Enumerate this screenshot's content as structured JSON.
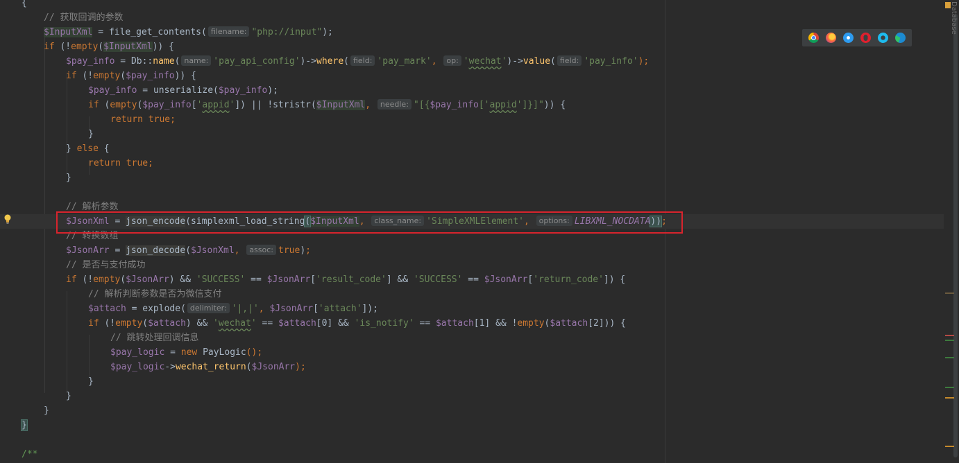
{
  "editor": {
    "side_panel_label": "Database",
    "browser_icons": [
      "chrome-icon",
      "firefox-icon",
      "safari-icon",
      "opera-icon",
      "ie-icon",
      "edge-icon"
    ],
    "lines": {
      "l0": "{",
      "l1_comment": "// 获取回调的参数",
      "l2": {
        "var": "$InputXml",
        "eq": " = ",
        "fn": "file_get_contents(",
        "hint": "filename:",
        "str": "\"php://input\"",
        "end": ");"
      },
      "l3": {
        "kw": "if",
        "open": " (!",
        "fn": "empty",
        "p1": "(",
        "var": "$InputXml",
        "end": ")) {"
      },
      "l4": {
        "var": "$pay_info",
        "eq": " = ",
        "cls": "Db::",
        "fn1": "name",
        "p1": "(",
        "hint1": "name:",
        "str1": "'pay_api_config'",
        "arrow1": ")->",
        "fn2": "where",
        "p2": "(",
        "hint2": "field:",
        "str2": "'pay_mark'",
        "comma": ", ",
        "hint3": "op:",
        "str3a": "'",
        "str3b": "wechat",
        "str3c": "'",
        "arrow2": ")->",
        "fn3": "value",
        "p3": "(",
        "hint4": "field:",
        "str4": "'pay_info'",
        "end": ");"
      },
      "l5": {
        "kw": "if",
        "open": " (!",
        "fn": "empty",
        "p1": "(",
        "var": "$pay_info",
        "end": ")) {"
      },
      "l6": {
        "var1": "$pay_info",
        "eq": " = ",
        "fn": "unserialize",
        "p1": "(",
        "var2": "$pay_info",
        "end": ");"
      },
      "l7": {
        "kw": "if",
        "open": " (",
        "fn1": "empty",
        "p1": "(",
        "var1": "$pay_info",
        "b1": "[",
        "str1a": "'",
        "str1b": "appid",
        "str1c": "'",
        "b2": "]) || !",
        "fn2": "stristr",
        "p2": "(",
        "var2": "$InputXml",
        "comma": ", ",
        "hint": "needle:",
        "str2": "\"[{",
        "var3": "$pay_info",
        "str3": "['",
        "str3b": "appid",
        "str4": "']}]\"",
        "end": ")) {"
      },
      "l8": {
        "kw1": "return",
        "kw2": " true",
        "end": ";"
      },
      "l9": "}",
      "l10": {
        "close": "} ",
        "kw": "else",
        "end": " {"
      },
      "l11": {
        "kw1": "return",
        "kw2": " true",
        "end": ";"
      },
      "l12": "}",
      "l14_comment": "// 解析参数",
      "l15": {
        "var": "$JsonXml",
        "eq": " = ",
        "fn1": "json_encode",
        "p1": "(",
        "fn2": "simplexml_load_string",
        "p2": "(",
        "var2": "$InputXml",
        "comma1": ", ",
        "hint1": "class_name:",
        "str1": "'SimpleXMLElement'",
        "comma2": ", ",
        "hint2": "options:",
        "cst": "LIBXML_NOCDATA",
        "end1": "))",
        "end2": ";"
      },
      "l16_comment": "// 转换数组",
      "l17": {
        "var": "$JsonArr",
        "eq": " = ",
        "fn": "json_decode",
        "p1": "(",
        "var2": "$JsonXml",
        "comma": ", ",
        "hint": "assoc:",
        "kw": "true",
        "end1": ")",
        "end2": ";"
      },
      "l18_comment": "// 是否与支付成功",
      "l19": {
        "kw": "if",
        "open": " (!",
        "fn": "empty",
        "p1": "(",
        "var1": "$JsonArr",
        "and1": ") && ",
        "str1": "'SUCCESS'",
        "eq1": " == ",
        "var2": "$JsonArr",
        "b1": "[",
        "str2": "'result_code'",
        "b2": "] && ",
        "str3": "'SUCCESS'",
        "eq2": " == ",
        "var3": "$JsonArr",
        "b3": "[",
        "str4": "'return_code'",
        "end": "]) {"
      },
      "l20_comment": "// 解析判断参数是否为微信支付",
      "l21": {
        "var": "$attach",
        "eq": " = ",
        "fn": "explode",
        "p1": "(",
        "hint": "delimiter:",
        "str": "'|,|'",
        "comma": ", ",
        "var2": "$JsonArr",
        "b1": "[",
        "str2": "'attach'",
        "end": "]);"
      },
      "l22": {
        "kw": "if",
        "open": " (!",
        "fn1": "empty",
        "p1": "(",
        "var1": "$attach",
        "a1": ") && ",
        "str1a": "'",
        "str1b": "wechat",
        "str1c": "'",
        "eq1": " == ",
        "var2": "$attach",
        "i1": "[0] && ",
        "str2": "'is_notify'",
        "eq2": " == ",
        "var3": "$attach",
        "i2": "[1] && !",
        "fn2": "empty",
        "p2": "(",
        "var4": "$attach",
        "end": "[2])) {"
      },
      "l23_comment": "// 跳转处理回调信息",
      "l24": {
        "var": "$pay_logic",
        "eq": " = ",
        "kw": "new",
        "cls": " PayLogic",
        "end": "();"
      },
      "l25": {
        "var": "$pay_logic",
        "arrow": "->",
        "fn": "wechat_return",
        "p1": "(",
        "var2": "$JsonArr",
        "end": ");"
      },
      "l26": "}",
      "l27": "}",
      "l28": "}",
      "l29": "}",
      "l31_doc": "/**"
    }
  }
}
